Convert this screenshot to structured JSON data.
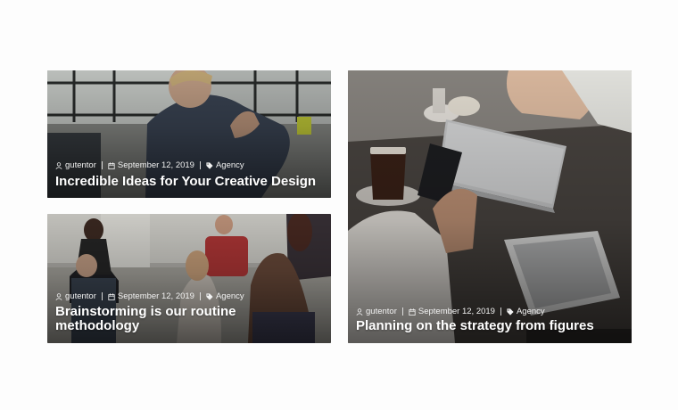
{
  "posts": [
    {
      "author": "gutentor",
      "date": "September 12, 2019",
      "category": "Agency",
      "title": "Incredible Ideas for Your Creative Design"
    },
    {
      "author": "gutentor",
      "date": "September 12, 2019",
      "category": "Agency",
      "title": "Brainstorming is our routine methodology"
    },
    {
      "author": "gutentor",
      "date": "September 12, 2019",
      "category": "Agency",
      "title": "Planning on the strategy from figures"
    }
  ],
  "icons": {
    "author": "user-icon",
    "date": "calendar-icon",
    "category": "tag-icon"
  }
}
